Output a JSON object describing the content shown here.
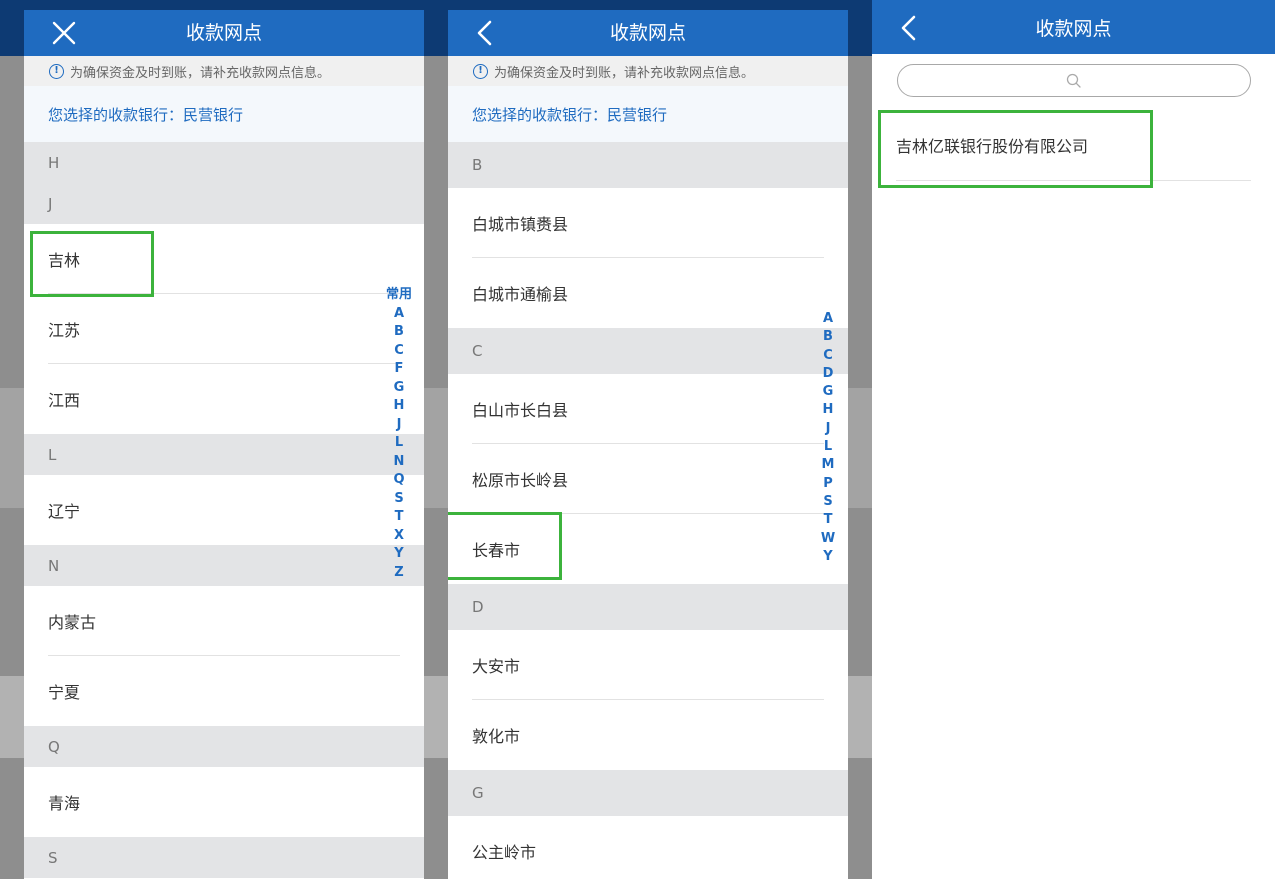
{
  "colors": {
    "header": "#1f6bc0",
    "accent": "#1f6bc0",
    "highlight": "#3cb33c",
    "group_bg": "#e3e4e6"
  },
  "panel1": {
    "title": "收款网点",
    "close_icon": "close-icon",
    "notice": "为确保资金及时到账，请补充收款网点信息。",
    "selected_bank": "您选择的收款银行：民营银行",
    "list": [
      {
        "type": "group",
        "label": "H"
      },
      {
        "type": "group",
        "label": "J"
      },
      {
        "type": "item",
        "label": "吉林"
      },
      {
        "type": "item",
        "label": "江苏"
      },
      {
        "type": "item",
        "label": "江西"
      },
      {
        "type": "group",
        "label": "L"
      },
      {
        "type": "item",
        "label": "辽宁"
      },
      {
        "type": "group",
        "label": "N"
      },
      {
        "type": "item",
        "label": "内蒙古"
      },
      {
        "type": "item",
        "label": "宁夏"
      },
      {
        "type": "group",
        "label": "Q"
      },
      {
        "type": "item",
        "label": "青海"
      },
      {
        "type": "group",
        "label": "S"
      }
    ],
    "index": [
      "常用",
      "A",
      "B",
      "C",
      "F",
      "G",
      "H",
      "J",
      "L",
      "N",
      "Q",
      "S",
      "T",
      "X",
      "Y",
      "Z"
    ]
  },
  "panel2": {
    "title": "收款网点",
    "back_icon": "back-chevron-icon",
    "notice": "为确保资金及时到账，请补充收款网点信息。",
    "selected_bank": "您选择的收款银行：民营银行",
    "list": [
      {
        "type": "group",
        "label": "B"
      },
      {
        "type": "item",
        "label": "白城市镇赉县"
      },
      {
        "type": "item",
        "label": "白城市通榆县"
      },
      {
        "type": "group",
        "label": "C"
      },
      {
        "type": "item",
        "label": "白山市长白县"
      },
      {
        "type": "item",
        "label": "松原市长岭县"
      },
      {
        "type": "item",
        "label": "长春市"
      },
      {
        "type": "group",
        "label": "D"
      },
      {
        "type": "item",
        "label": "大安市"
      },
      {
        "type": "item",
        "label": "敦化市"
      },
      {
        "type": "group",
        "label": "G"
      },
      {
        "type": "item",
        "label": "公主岭市"
      }
    ],
    "index": [
      "A",
      "B",
      "C",
      "D",
      "G",
      "H",
      "J",
      "L",
      "M",
      "P",
      "S",
      "T",
      "W",
      "Y"
    ]
  },
  "panel3": {
    "title": "收款网点",
    "back_icon": "back-chevron-icon",
    "search_placeholder": "",
    "results": [
      "吉林亿联银行股份有限公司"
    ]
  }
}
